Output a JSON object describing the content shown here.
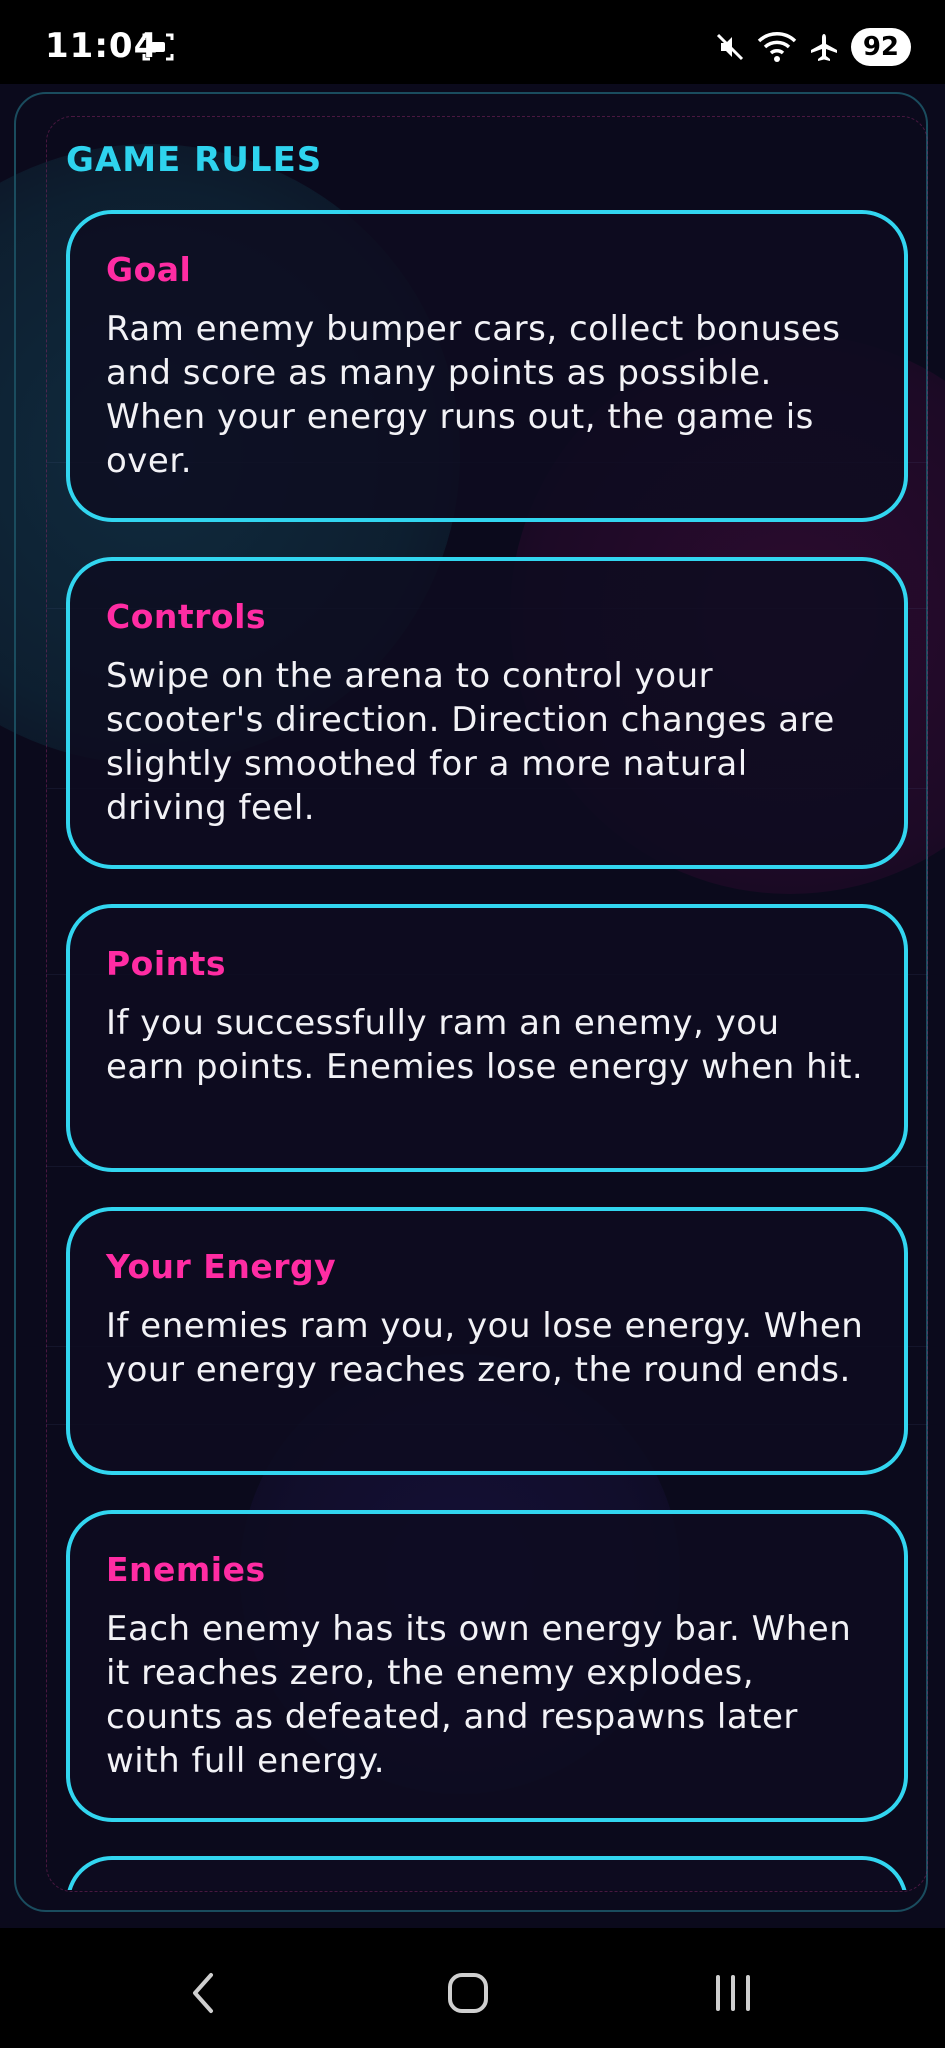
{
  "status_bar": {
    "time": "11:04",
    "battery": "92",
    "icons": [
      "screenshot-icon",
      "mute-icon",
      "wifi-icon",
      "airplane-mode-icon"
    ]
  },
  "rules": {
    "title": "GAME RULES",
    "cards": [
      {
        "title": "Goal",
        "text": "Ram enemy bumper cars, collect bonuses and score as many points as possible. When your energy runs out, the game is over."
      },
      {
        "title": "Controls",
        "text": "Swipe on the arena to control your scooter's direction. Direction changes are slightly smoothed for a more natural driving feel."
      },
      {
        "title": "Points",
        "text": "If you successfully ram an enemy, you earn points. Enemies lose energy when hit."
      },
      {
        "title": "Your Energy",
        "text": "If enemies ram you, you lose energy. When your energy reaches zero, the round ends."
      },
      {
        "title": "Enemies",
        "text": "Each enemy has its own energy bar. When it reaches zero, the enemy explodes, counts as defeated, and respawns later with full energy."
      }
    ]
  },
  "nav_bar": {
    "buttons": [
      "back-icon",
      "home-icon",
      "recents-icon"
    ]
  },
  "colors": {
    "accent_cyan": "#32d6f0",
    "accent_pink": "#ff2ca3",
    "background": "#0b0a1c"
  }
}
